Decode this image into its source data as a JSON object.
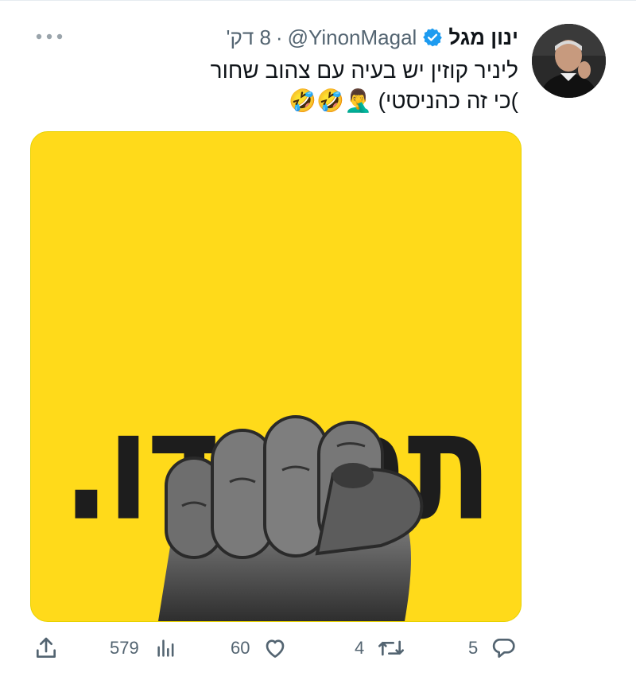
{
  "tweet": {
    "author_name": "ינון מגל",
    "handle": "@YinonMagal",
    "separator": "·",
    "time": "8 דק'",
    "text_line1": "ליניר קוזין יש בעיה עם צהוב שחור",
    "text_line2": ")כי זה כהניסטי) 🤦‍♂️🤣🤣",
    "media": {
      "headline": "תתנגדו."
    },
    "actions": {
      "replies": "5",
      "retweets": "4",
      "likes": "60",
      "views": "579"
    }
  },
  "colors": {
    "verified": "#1d9bf0",
    "media_background": "#ffda1a",
    "secondary_text": "#536471"
  },
  "icons": [
    "more-icon",
    "verified-badge-icon",
    "reply-icon",
    "retweet-icon",
    "like-icon",
    "views-icon",
    "share-icon"
  ]
}
